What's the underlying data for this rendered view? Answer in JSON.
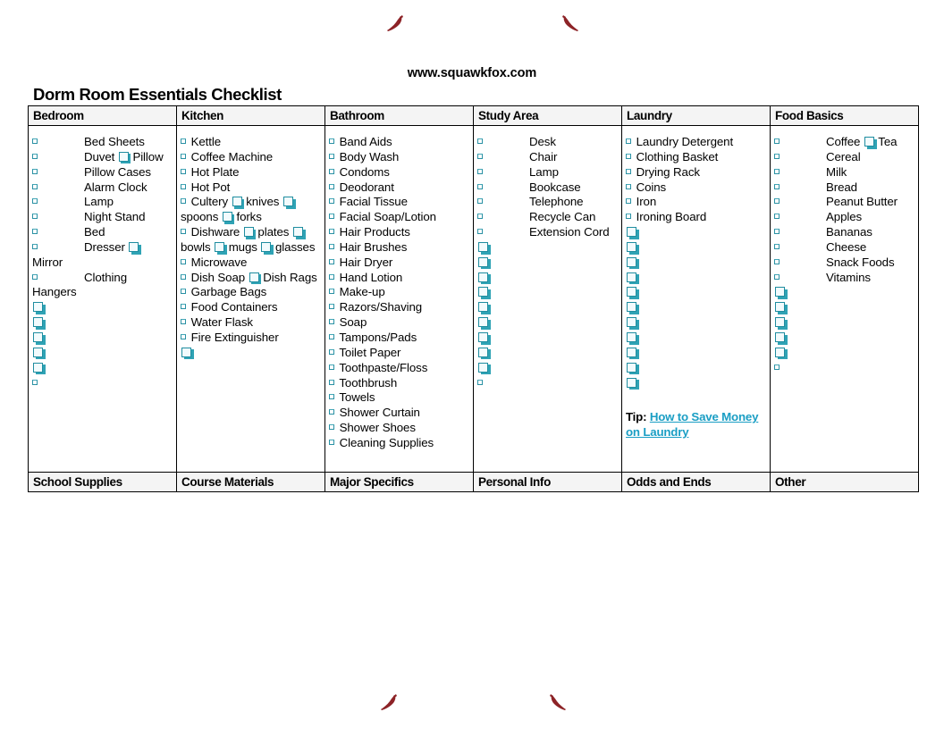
{
  "site_url": "www.squawkfox.com",
  "title": "Dorm Room Essentials Checklist",
  "decor": {
    "icon_name": "high-heel-shoe-icon",
    "color": "#8d2327",
    "count": 4
  },
  "colors": {
    "checkbox_teal": "#2a91a4",
    "link_blue": "#1a9ec4",
    "header_bg": "#f4f4f4",
    "border": "#000000",
    "text": "#000000"
  },
  "columns": [
    {
      "header": "Bedroom",
      "footer": "School Supplies",
      "indented": true,
      "items": [
        "Bed Sheets",
        "Duvet ▢ Pillow",
        "Pillow Cases",
        "Alarm Clock",
        "Lamp",
        "Night Stand",
        "Bed",
        "Dresser ▢ Mirror",
        "Clothing Hangers"
      ],
      "blank_checkboxes": 5,
      "trailing_bullets": 1
    },
    {
      "header": "Kitchen",
      "footer": "Course Materials",
      "indented": false,
      "items": [
        "Kettle",
        "Coffee Machine",
        "Hot Plate",
        "Hot Pot",
        "Cultery ▢ knives ▢ spoons ▢ forks",
        "Dishware ▢ plates ▢ bowls ▢ mugs ▢ glasses",
        "Microwave",
        "Dish Soap ▢ Dish Rags",
        "Garbage Bags",
        "Food Containers",
        "Water Flask",
        "Fire Extinguisher"
      ],
      "blank_checkboxes": 1,
      "trailing_bullets": 0
    },
    {
      "header": "Bathroom",
      "footer": "Major Specifics",
      "indented": false,
      "items": [
        "Band Aids",
        "Body Wash",
        "Condoms",
        "Deodorant",
        "Facial Tissue",
        "Facial Soap/Lotion",
        "Hair Products",
        "Hair Brushes",
        "Hair Dryer",
        "Hand Lotion",
        "Make-up",
        "Razors/Shaving",
        "Soap",
        "Tampons/Pads",
        "Toilet Paper",
        "Toothpaste/Floss",
        "Toothbrush",
        "Towels",
        "Shower Curtain",
        "Shower Shoes",
        "Cleaning Supplies"
      ],
      "blank_checkboxes": 0,
      "trailing_bullets": 0
    },
    {
      "header": "Study Area",
      "footer": "Personal Info",
      "indented": true,
      "items": [
        "Desk",
        "Chair",
        "Lamp",
        "Bookcase",
        "Telephone",
        "Recycle Can",
        "Extension Cord"
      ],
      "blank_checkboxes": 9,
      "trailing_bullets": 1
    },
    {
      "header": "Laundry",
      "footer": "Odds and Ends",
      "indented": false,
      "items": [
        "Laundry Detergent",
        "Clothing Basket",
        "Drying Rack",
        "Coins",
        "Iron",
        "Ironing Board"
      ],
      "blank_checkboxes": 11,
      "trailing_bullets": 0,
      "tip": {
        "label": "Tip:",
        "link_text": "How to Save Money on Laundry"
      }
    },
    {
      "header": "Food Basics",
      "footer": "Other",
      "indented": true,
      "items": [
        "Coffee ▢ Tea",
        "Cereal",
        "Milk",
        "Bread",
        "Peanut Butter",
        "Apples",
        "Bananas",
        "Cheese",
        "Snack Foods",
        "Vitamins"
      ],
      "blank_checkboxes": 5,
      "trailing_bullets": 1
    }
  ]
}
